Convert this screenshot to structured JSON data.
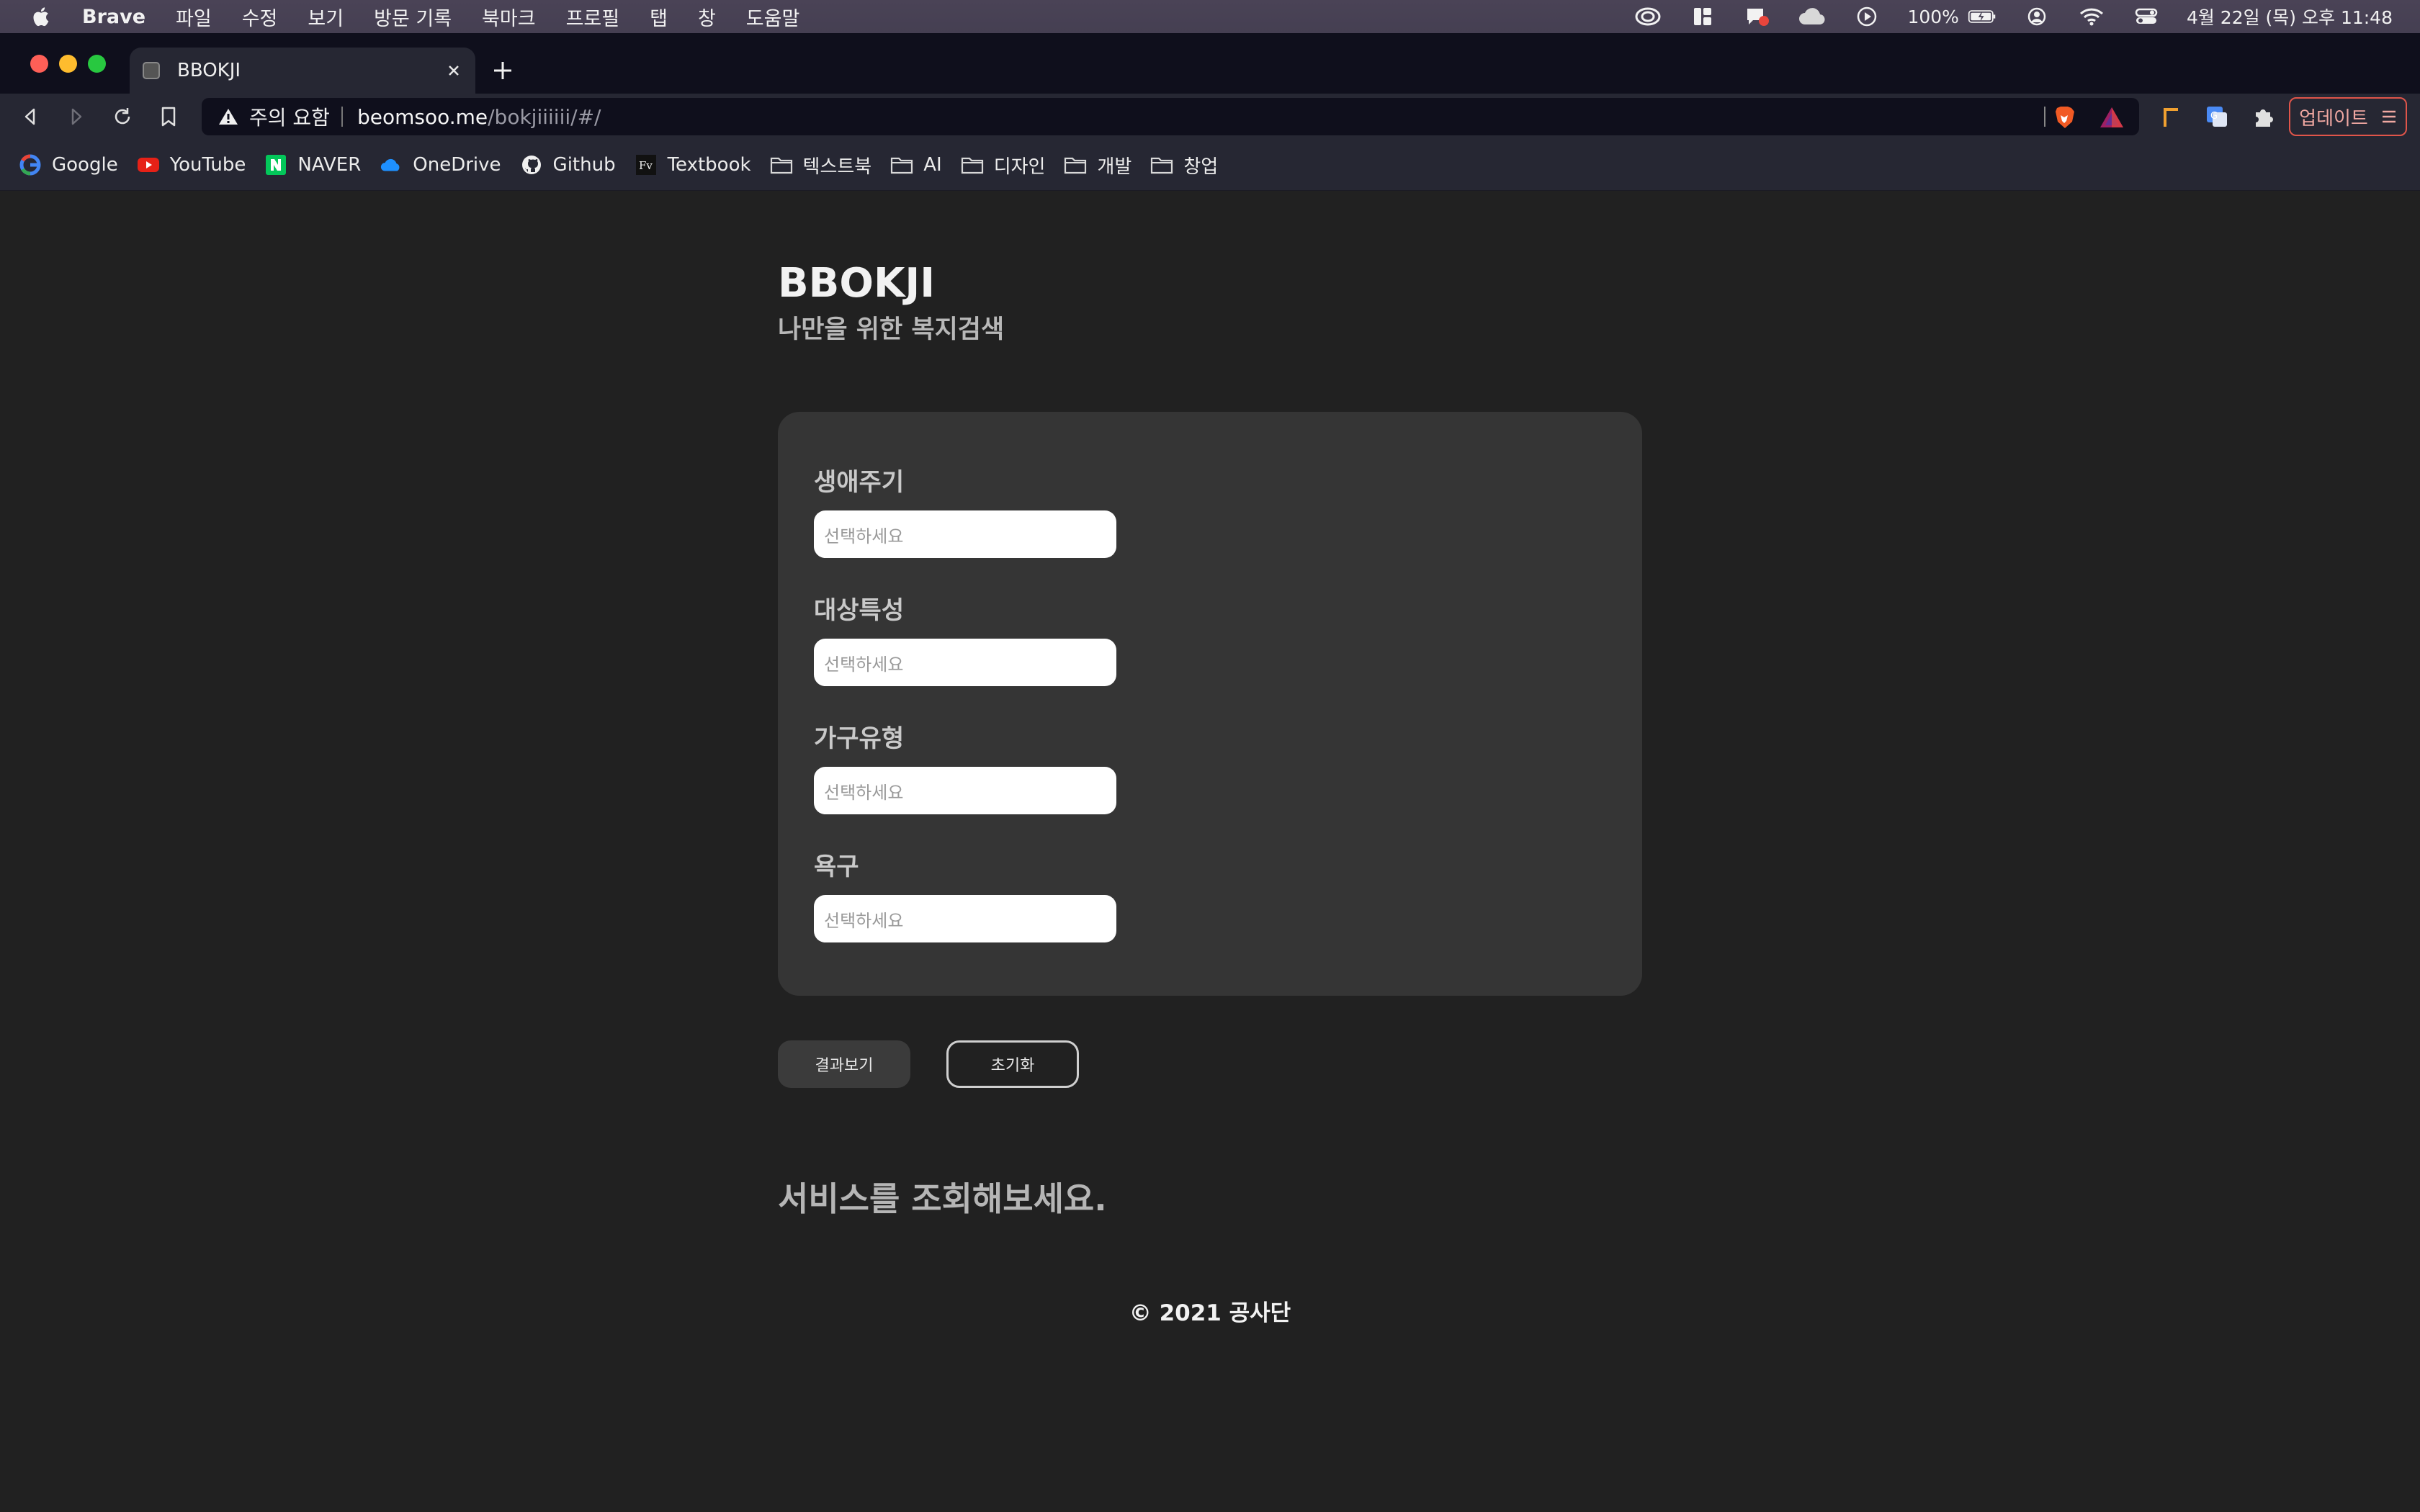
{
  "menubar": {
    "app_name": "Brave",
    "items": [
      "파일",
      "수정",
      "보기",
      "방문 기록",
      "북마크",
      "프로필",
      "탭",
      "창",
      "도움말"
    ],
    "battery": "100%",
    "datetime": "4월 22일 (목) 오후 11:48"
  },
  "browser": {
    "tab_title": "BBOKJI",
    "security_warning": "주의 요함",
    "url_host": "beomsoo.me",
    "url_path": "/bokjiiiiii/#/",
    "update_label": "업데이트"
  },
  "bookmarks": [
    {
      "label": "Google",
      "icon": "google-icon"
    },
    {
      "label": "YouTube",
      "icon": "youtube-icon"
    },
    {
      "label": "NAVER",
      "icon": "naver-icon"
    },
    {
      "label": "OneDrive",
      "icon": "onedrive-icon"
    },
    {
      "label": "Github",
      "icon": "github-icon"
    },
    {
      "label": "Textbook",
      "icon": "textbook-icon"
    },
    {
      "label": "텍스트북",
      "icon": "folder-icon"
    },
    {
      "label": "AI",
      "icon": "folder-icon"
    },
    {
      "label": "디자인",
      "icon": "folder-icon"
    },
    {
      "label": "개발",
      "icon": "folder-icon"
    },
    {
      "label": "창업",
      "icon": "folder-icon"
    }
  ],
  "page": {
    "title": "BBOKJI",
    "subtitle": "나만을 위한 복지검색",
    "fields": [
      {
        "label": "생애주기",
        "placeholder": "선택하세요"
      },
      {
        "label": "대상특성",
        "placeholder": "선택하세요"
      },
      {
        "label": "가구유형",
        "placeholder": "선택하세요"
      },
      {
        "label": "욕구",
        "placeholder": "선택하세요"
      }
    ],
    "result_button": "결과보기",
    "reset_button": "초기화",
    "result_message": "서비스를 조회해보세요.",
    "footer": "© 2021 공사단"
  },
  "colors": {
    "page_background": "#212121",
    "card_background": "#353535",
    "update_accent": "#e0554a"
  }
}
